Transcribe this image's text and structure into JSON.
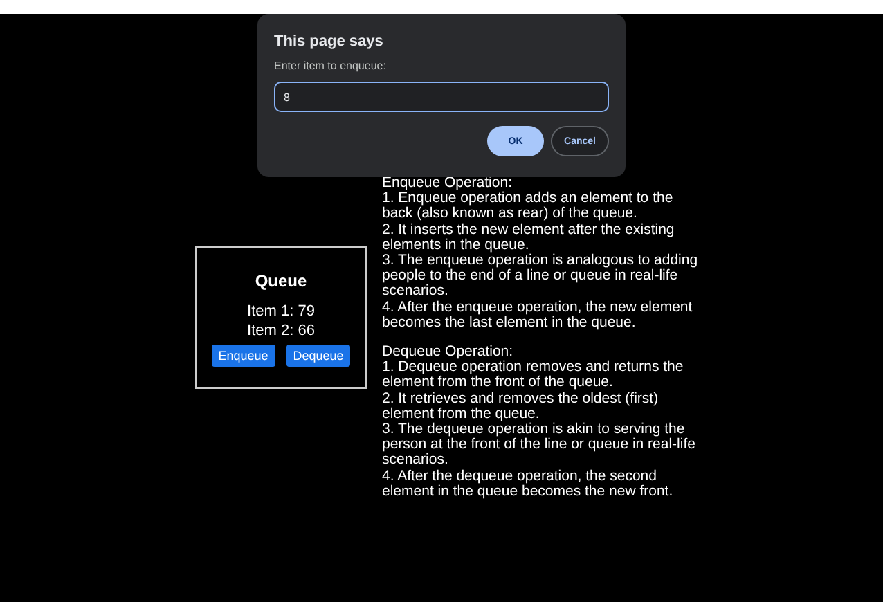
{
  "dialog": {
    "title": "This page says",
    "message": "Enter item to enqueue:",
    "value": "8",
    "buttons": [
      {
        "label": "OK",
        "kind": "primary"
      },
      {
        "label": "Cancel",
        "kind": "secondary"
      }
    ]
  },
  "queue": {
    "title": "Queue",
    "items": [
      "Item 1: 79",
      "Item 2: 66"
    ],
    "buttons": [
      "Enqueue",
      "Dequeue"
    ]
  },
  "sections": [
    {
      "heading": "Enqueue Operation:",
      "points": [
        "1. Enqueue operation adds an element to the back (also known as rear) of the queue.",
        "2. It inserts the new element after the existing elements in the queue.",
        "3. The enqueue operation is analogous to adding people to the end of a line or queue in real-life scenarios.",
        "4. After the enqueue operation, the new element becomes the last element in the queue."
      ]
    },
    {
      "heading": "Dequeue Operation:",
      "points": [
        "1. Dequeue operation removes and returns the element from the front of the queue.",
        "2. It retrieves and removes the oldest (first) element from the queue.",
        "3. The dequeue operation is akin to serving the person at the front of the line or queue in real-life scenarios.",
        "4. After the dequeue operation, the second element in the queue becomes the new front."
      ]
    }
  ]
}
